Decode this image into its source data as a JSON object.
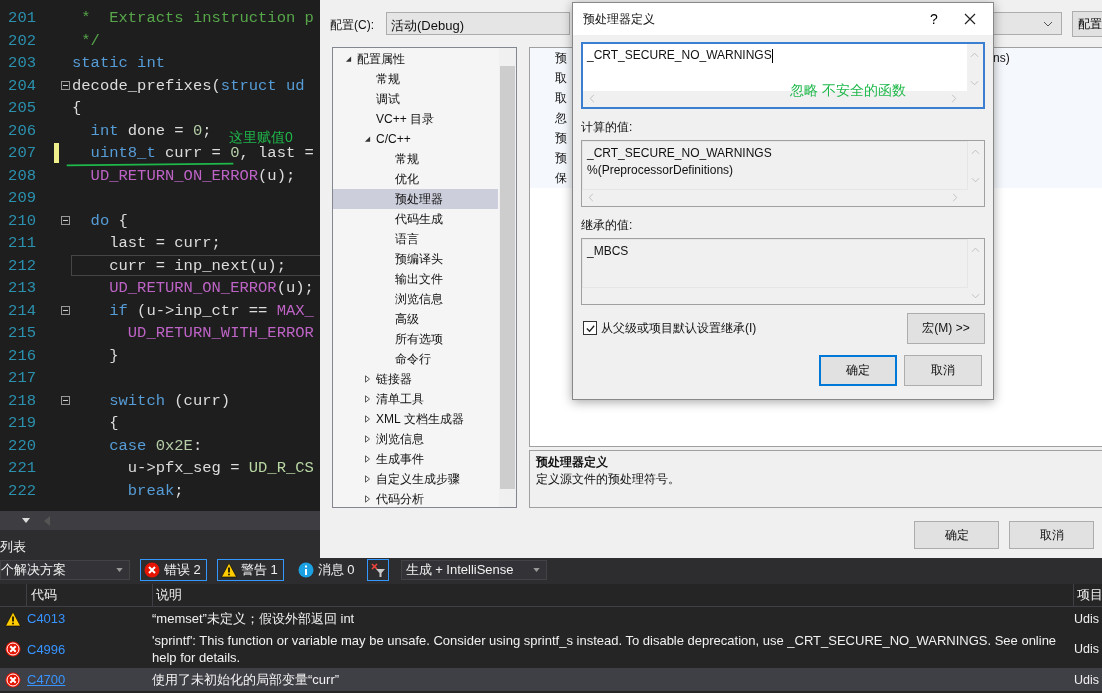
{
  "editor": {
    "lines": [
      {
        "number": "201",
        "tokens": [
          {
            "text": " *  Extracts instruction p",
            "kind": "comment"
          }
        ],
        "fold": false,
        "changed": false,
        "selected": false
      },
      {
        "number": "202",
        "tokens": [
          {
            "text": " */",
            "kind": "comment"
          }
        ],
        "fold": false,
        "changed": false,
        "selected": false
      },
      {
        "number": "203",
        "tokens": [
          {
            "text": "static int",
            "kind": "keyword"
          }
        ],
        "fold": false,
        "changed": false,
        "selected": false
      },
      {
        "number": "204",
        "tokens": [
          {
            "text": "decode_prefixes(",
            "kind": "plain"
          },
          {
            "text": "struct ud",
            "kind": "keyword"
          }
        ],
        "fold": true,
        "changed": false,
        "selected": false
      },
      {
        "number": "205",
        "tokens": [
          {
            "text": "{",
            "kind": "plain"
          }
        ],
        "fold": false,
        "changed": false,
        "selected": false
      },
      {
        "number": "206",
        "tokens": [
          {
            "text": "  int",
            "kind": "keyword"
          },
          {
            "text": " done = ",
            "kind": "plain"
          },
          {
            "text": "0",
            "kind": "number"
          },
          {
            "text": ";",
            "kind": "plain"
          }
        ],
        "fold": false,
        "changed": false,
        "selected": false
      },
      {
        "number": "207",
        "tokens": [
          {
            "text": "  uint8_t",
            "kind": "keyword"
          },
          {
            "text": " curr = ",
            "kind": "plain"
          },
          {
            "text": "0",
            "kind": "number"
          },
          {
            "text": ", last =",
            "kind": "plain"
          }
        ],
        "fold": false,
        "changed": true,
        "selected": false
      },
      {
        "number": "208",
        "tokens": [
          {
            "text": "  UD_RETURN_ON_ERROR",
            "kind": "macro"
          },
          {
            "text": "(u);",
            "kind": "plain"
          }
        ],
        "fold": false,
        "changed": false,
        "selected": false
      },
      {
        "number": "209",
        "fold": false,
        "changed": false,
        "selected": false
      },
      {
        "number": "210",
        "tokens": [
          {
            "text": "  do",
            "kind": "keyword"
          },
          {
            "text": " {",
            "kind": "plain"
          }
        ],
        "fold": true,
        "changed": false,
        "selected": false
      },
      {
        "number": "211",
        "tokens": [
          {
            "text": "    last = curr;",
            "kind": "plain"
          }
        ],
        "fold": false,
        "changed": false,
        "selected": false
      },
      {
        "number": "212",
        "tokens": [
          {
            "text": "    curr = inp_next(u);",
            "kind": "plain"
          }
        ],
        "fold": false,
        "changed": false,
        "selected": true
      },
      {
        "number": "213",
        "tokens": [
          {
            "text": "    UD_RETURN_ON_ERROR",
            "kind": "macro"
          },
          {
            "text": "(u);",
            "kind": "plain"
          }
        ],
        "fold": false,
        "changed": false,
        "selected": false
      },
      {
        "number": "214",
        "tokens": [
          {
            "text": "    if",
            "kind": "keyword"
          },
          {
            "text": " (u->inp_ctr == ",
            "kind": "plain"
          },
          {
            "text": "MAX_",
            "kind": "macro"
          }
        ],
        "fold": true,
        "changed": false,
        "selected": false
      },
      {
        "number": "215",
        "tokens": [
          {
            "text": "      UD_RETURN_WITH_ERROR",
            "kind": "macro"
          }
        ],
        "fold": false,
        "changed": false,
        "selected": false
      },
      {
        "number": "216",
        "tokens": [
          {
            "text": "    }",
            "kind": "plain"
          }
        ],
        "fold": false,
        "changed": false,
        "selected": false
      },
      {
        "number": "217",
        "fold": false,
        "changed": false,
        "selected": false
      },
      {
        "number": "218",
        "tokens": [
          {
            "text": "    switch",
            "kind": "keyword"
          },
          {
            "text": " (curr)",
            "kind": "plain"
          }
        ],
        "fold": true,
        "changed": false,
        "selected": false
      },
      {
        "number": "219",
        "tokens": [
          {
            "text": "    {",
            "kind": "plain"
          }
        ],
        "fold": false,
        "changed": false,
        "selected": false
      },
      {
        "number": "220",
        "tokens": [
          {
            "text": "    case ",
            "kind": "keyword"
          },
          {
            "text": "0x2E",
            "kind": "number"
          },
          {
            "text": ":",
            "kind": "plain"
          }
        ],
        "fold": false,
        "changed": false,
        "selected": false
      },
      {
        "number": "221",
        "tokens": [
          {
            "text": "      u->pfx_seg = ",
            "kind": "plain"
          },
          {
            "text": "UD_R_CS",
            "kind": "enum"
          }
        ],
        "fold": false,
        "changed": false,
        "selected": false
      },
      {
        "number": "222",
        "tokens": [
          {
            "text": "      break",
            "kind": "keyword"
          },
          {
            "text": ";",
            "kind": "plain"
          }
        ],
        "fold": false,
        "changed": false,
        "selected": false
      }
    ],
    "annotation": "这里赋值0"
  },
  "property_pages": {
    "config_label": "配置(C):",
    "config_value": "活动(Debug)",
    "right_button": "配置",
    "tree": [
      {
        "label": "配置属性",
        "kind": "branch",
        "expanded": true,
        "selected": false,
        "children": [
          {
            "label": "常规",
            "kind": "leaf",
            "selected": false
          },
          {
            "label": "调试",
            "kind": "leaf",
            "selected": false
          },
          {
            "label": "VC++ 目录",
            "kind": "leaf",
            "selected": false
          },
          {
            "label": "C/C++",
            "kind": "branch",
            "expanded": true,
            "selected": false,
            "children": [
              {
                "label": "常规",
                "kind": "leaf",
                "selected": false
              },
              {
                "label": "优化",
                "kind": "leaf",
                "selected": false
              },
              {
                "label": "预处理器",
                "kind": "leaf",
                "selected": true
              },
              {
                "label": "代码生成",
                "kind": "leaf",
                "selected": false
              },
              {
                "label": "语言",
                "kind": "leaf",
                "selected": false
              },
              {
                "label": "预编译头",
                "kind": "leaf",
                "selected": false
              },
              {
                "label": "输出文件",
                "kind": "leaf",
                "selected": false
              },
              {
                "label": "浏览信息",
                "kind": "leaf",
                "selected": false
              },
              {
                "label": "高级",
                "kind": "leaf",
                "selected": false
              },
              {
                "label": "所有选项",
                "kind": "leaf",
                "selected": false
              },
              {
                "label": "命令行",
                "kind": "leaf",
                "selected": false
              }
            ]
          },
          {
            "label": "链接器",
            "kind": "branch",
            "expanded": false,
            "selected": false
          },
          {
            "label": "清单工具",
            "kind": "branch",
            "expanded": false,
            "selected": false
          },
          {
            "label": "XML 文档生成器",
            "kind": "branch",
            "expanded": false,
            "selected": false
          },
          {
            "label": "浏览信息",
            "kind": "branch",
            "expanded": false,
            "selected": false
          },
          {
            "label": "生成事件",
            "kind": "branch",
            "expanded": false,
            "selected": false
          },
          {
            "label": "自定义生成步骤",
            "kind": "branch",
            "expanded": false,
            "selected": false
          },
          {
            "label": "代码分析",
            "kind": "branch",
            "expanded": false,
            "selected": false
          }
        ]
      }
    ],
    "grid_rows": [
      {
        "label": "预",
        "value": "ns)"
      },
      {
        "label": "取"
      },
      {
        "label": "取"
      },
      {
        "label": "忽"
      },
      {
        "label": "预"
      },
      {
        "label": "预"
      },
      {
        "label": "保"
      }
    ],
    "description": {
      "title": "预处理器定义",
      "text": "定义源文件的预处理符号。"
    },
    "buttons": [
      "确定",
      "取消"
    ]
  },
  "dialog": {
    "title": "预处理器定义",
    "help": "?",
    "value": "_CRT_SECURE_NO_WARNINGS",
    "annotation": "忽略 不安全的函数",
    "computed_label": "计算的值:",
    "computed_lines": [
      "_CRT_SECURE_NO_WARNINGS",
      "%(PreprocessorDefinitions)"
    ],
    "inherited_label": "继承的值:",
    "inherited_lines": [
      "_MBCS"
    ],
    "inherit": {
      "label": "从父级或项目默认设置继承(I)",
      "checked": true
    },
    "macro_button": "宏(M) >>",
    "buttons": [
      "确定",
      "取消"
    ]
  },
  "error_list": {
    "title": "列表",
    "scope": "个解决方案",
    "filters": [
      {
        "kind": "error",
        "label": "错误 2",
        "selected": true
      },
      {
        "kind": "warning",
        "label": "警告 1",
        "selected": true
      },
      {
        "kind": "info",
        "label": "消息 0",
        "selected": false
      }
    ],
    "source": "生成 + IntelliSense",
    "columns": [
      "代码",
      "说明",
      "项目"
    ],
    "rows": [
      {
        "kind": "warning",
        "code": "C4013",
        "description": "“memset”未定义；假设外部返回 int",
        "project": "Udis",
        "selected": false
      },
      {
        "kind": "error",
        "code": "C4996",
        "description": "'sprintf': This function or variable may be unsafe. Consider using sprintf_s instead. To disable deprecation, use _CRT_SECURE_NO_WARNINGS. See online help for details.",
        "project": "Udis",
        "selected": false
      },
      {
        "kind": "error",
        "code": "C4700",
        "description": "使用了未初始化的局部变量“curr”",
        "project": "Udis",
        "selected": true
      }
    ]
  }
}
